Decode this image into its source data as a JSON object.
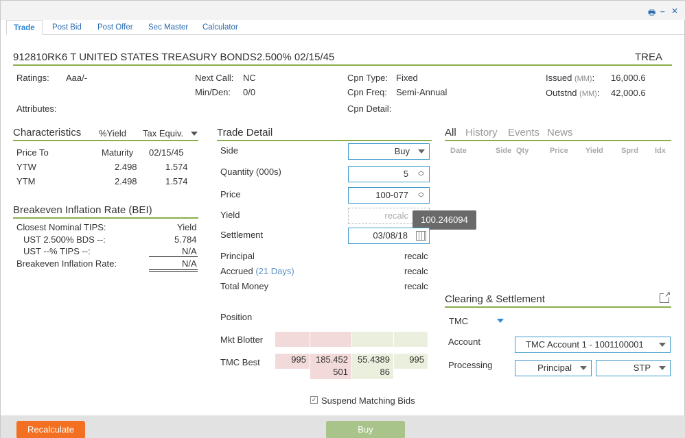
{
  "window": {
    "controls": {
      "print": "🖶",
      "minimize": "–",
      "close": "✕"
    }
  },
  "tabs": [
    "Trade",
    "Post Bid",
    "Post Offer",
    "Sec Master",
    "Calculator"
  ],
  "security": {
    "title": "912810RK6  T UNITED STATES TREASURY BONDS2.500% 02/15/45",
    "right": "TREA"
  },
  "info": {
    "ratings_label": "Ratings:",
    "ratings_value": "Aaa/-",
    "attributes_label": "Attributes:",
    "next_call_label": "Next Call:",
    "next_call_value": "NC",
    "min_den_label": "Min/Den:",
    "min_den_value": "0/0",
    "cpn_type_label": "Cpn Type:",
    "cpn_type_value": "Fixed",
    "cpn_freq_label": "Cpn Freq:",
    "cpn_freq_value": "Semi-Annual",
    "cpn_detail_label": "Cpn Detail:",
    "issued_label": "Issued",
    "issued_unit": "(MM)",
    "issued_colon": ":",
    "issued_value": "16,000.6",
    "outstnd_label": "Outstnd",
    "outstnd_unit": "(MM)",
    "outstnd_colon": ":",
    "outstnd_value": "42,000.6"
  },
  "characteristics": {
    "title": "Characteristics",
    "col1": "%Yield",
    "col2": "Tax Equiv.",
    "price_to_label": "Price To",
    "price_to_col1": "Maturity",
    "price_to_col2": "02/15/45",
    "rows": [
      {
        "label": "YTW",
        "v1": "2.498",
        "v2": "1.574"
      },
      {
        "label": "YTM",
        "v1": "2.498",
        "v2": "1.574"
      }
    ]
  },
  "bei": {
    "title": "Breakeven Inflation Rate (BEI)",
    "closest_label": "Closest Nominal TIPS:",
    "yield_label": "Yield",
    "ust_bds_label": "UST 2.500% BDS --:",
    "ust_bds_value": "5.784",
    "ust_tips_label": "UST --% TIPS --:",
    "ust_tips_value": "N/A",
    "ber_label": "Breakeven Inflation Rate:",
    "ber_value": "N/A"
  },
  "trade_detail": {
    "title": "Trade Detail",
    "side_label": "Side",
    "side_value": "Buy",
    "quantity_label": "Quantity (000s)",
    "quantity_value": "5",
    "price_label": "Price",
    "price_value": "100-077",
    "yield_label": "Yield",
    "yield_placeholder": "recalc",
    "settlement_label": "Settlement",
    "settlement_value": "03/08/18",
    "principal_label": "Principal",
    "principal_value": "recalc",
    "accrued_label": "Accrued",
    "accrued_days": "(21 Days)",
    "accrued_value": "recalc",
    "total_label": "Total Money",
    "total_value": "recalc",
    "position_label": "Position",
    "mkt_blotter_label": "Mkt Blotter",
    "tmc_best_label": "TMC Best",
    "tmc_best_cells": [
      "995",
      "185.452 501",
      "55.4389 86",
      "995"
    ],
    "tmc_best_c2_l1": "185.452",
    "tmc_best_c2_l2": "501",
    "tmc_best_c3_l1": "55.4389",
    "tmc_best_c3_l2": "86",
    "suspend_label": "Suspend Matching Bids",
    "suspend_checked": true,
    "tooltip": "100.246094"
  },
  "history": {
    "tabs": [
      "All",
      "History",
      "Events",
      "News"
    ],
    "columns": [
      "Date",
      "Side",
      "Qty",
      "Price",
      "Yield",
      "Sprd",
      "Idx"
    ]
  },
  "clearing": {
    "title": "Clearing & Settlement",
    "firm": "TMC",
    "account_label": "Account",
    "account_value": "TMC Account 1 - 1001100001",
    "processing_label": "Processing",
    "processing_value1": "Principal",
    "processing_value2": "STP"
  },
  "footer": {
    "recalculate": "Recalculate",
    "buy": "Buy"
  },
  "colors": {
    "accent_green": "#8aae4a",
    "link_blue": "#2a6ab0",
    "orange": "#f36f21",
    "buy_button": "#a8c48a"
  }
}
